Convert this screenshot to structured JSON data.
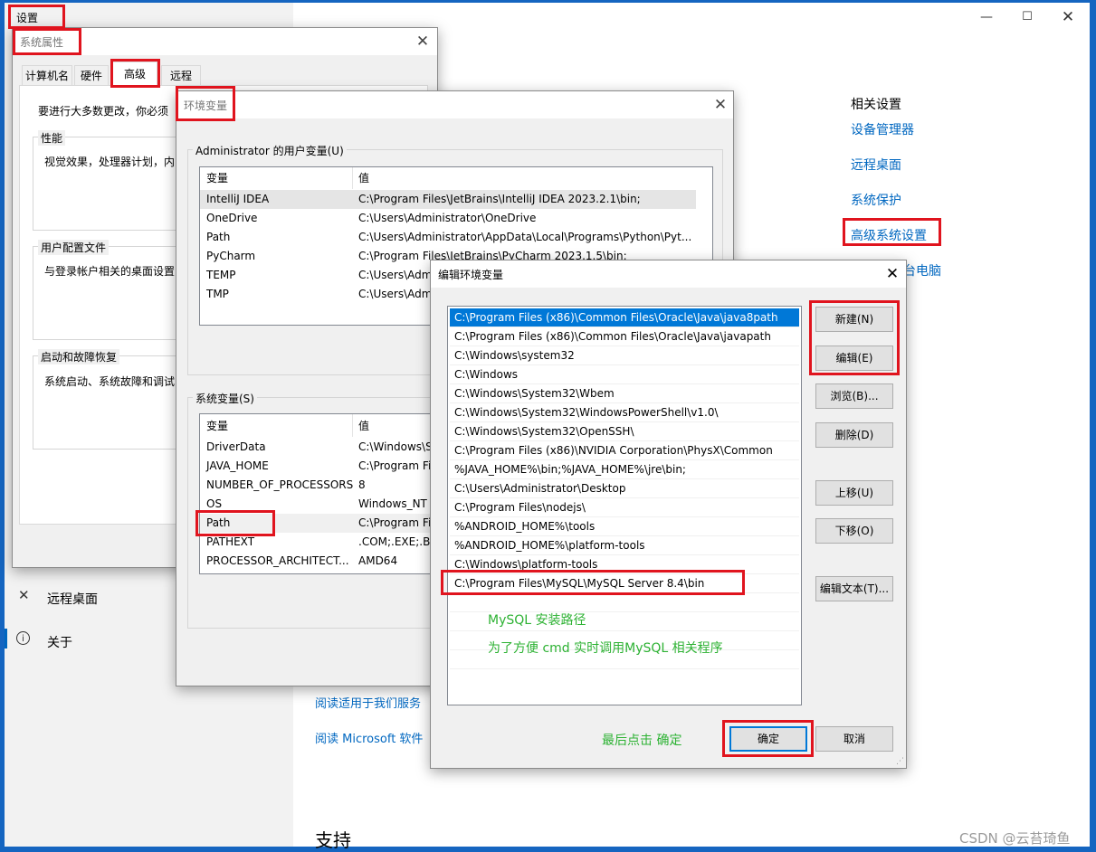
{
  "settings": {
    "title": "设置",
    "related_heading": "相关设置",
    "related_links": [
      "设备管理器",
      "远程桌面",
      "系统保护",
      "高级系统设置"
    ],
    "rename_partial": "台电脑",
    "nav_remote": "远程桌面",
    "nav_about": "关于",
    "read_service": "阅读适用于我们服务",
    "read_license": "阅读 Microsoft 软件",
    "support": "支持"
  },
  "sysprops": {
    "title": "系统属性",
    "tabs": [
      "计算机名",
      "硬件",
      "高级",
      "远程"
    ],
    "intro": "要进行大多数更改，你必须",
    "perf_label": "性能",
    "perf_text": "视觉效果，处理器计划，内",
    "profile_label": "用户配置文件",
    "profile_text": "与登录帐户相关的桌面设置",
    "startup_label": "启动和故障恢复",
    "startup_text": "系统启动、系统故障和调试"
  },
  "envvars": {
    "title": "环境变量",
    "user_group": "Administrator 的用户变量(U)",
    "sys_group": "系统变量(S)",
    "col_var": "变量",
    "col_val": "值",
    "user_rows": [
      {
        "name": "IntelliJ IDEA",
        "value": "C:\\Program Files\\JetBrains\\IntelliJ IDEA 2023.2.1\\bin;"
      },
      {
        "name": "OneDrive",
        "value": "C:\\Users\\Administrator\\OneDrive"
      },
      {
        "name": "Path",
        "value": "C:\\Users\\Administrator\\AppData\\Local\\Programs\\Python\\Pyt..."
      },
      {
        "name": "PyCharm",
        "value": "C:\\Program Files\\JetBrains\\PyCharm 2023.1.5\\bin;"
      },
      {
        "name": "TEMP",
        "value": "C:\\Users\\Adm"
      },
      {
        "name": "TMP",
        "value": "C:\\Users\\Adm"
      }
    ],
    "sys_rows": [
      {
        "name": "DriverData",
        "value": "C:\\Windows\\S"
      },
      {
        "name": "JAVA_HOME",
        "value": "C:\\Program Fi"
      },
      {
        "name": "NUMBER_OF_PROCESSORS",
        "value": "8"
      },
      {
        "name": "OS",
        "value": "Windows_NT"
      },
      {
        "name": "Path",
        "value": "C:\\Program Fi"
      },
      {
        "name": "PATHEXT",
        "value": ".COM;.EXE;.BA"
      },
      {
        "name": "PROCESSOR_ARCHITECT...",
        "value": "AMD64"
      }
    ]
  },
  "editenv": {
    "title": "编辑环境变量",
    "items": [
      "C:\\Program Files (x86)\\Common Files\\Oracle\\Java\\java8path",
      "C:\\Program Files (x86)\\Common Files\\Oracle\\Java\\javapath",
      "C:\\Windows\\system32",
      "C:\\Windows",
      "C:\\Windows\\System32\\Wbem",
      "C:\\Windows\\System32\\WindowsPowerShell\\v1.0\\",
      "C:\\Windows\\System32\\OpenSSH\\",
      "C:\\Program Files (x86)\\NVIDIA Corporation\\PhysX\\Common",
      "%JAVA_HOME%\\bin;%JAVA_HOME%\\jre\\bin;",
      "C:\\Users\\Administrator\\Desktop",
      "C:\\Program Files\\nodejs\\",
      "%ANDROID_HOME%\\tools",
      "%ANDROID_HOME%\\platform-tools",
      "C:\\Windows\\platform-tools",
      "C:\\Program Files\\MySQL\\MySQL Server 8.4\\bin"
    ],
    "buttons": {
      "new": "新建(N)",
      "edit": "编辑(E)",
      "browse": "浏览(B)...",
      "delete": "删除(D)",
      "up": "上移(U)",
      "down": "下移(O)",
      "edit_text": "编辑文本(T)...",
      "ok": "确定",
      "cancel": "取消"
    },
    "note1": "MySQL 安装路径",
    "note2": "为了方便 cmd 实时调用MySQL 相关程序",
    "note3": "最后点击 确定"
  },
  "watermark": "CSDN @云苔琦鱼"
}
